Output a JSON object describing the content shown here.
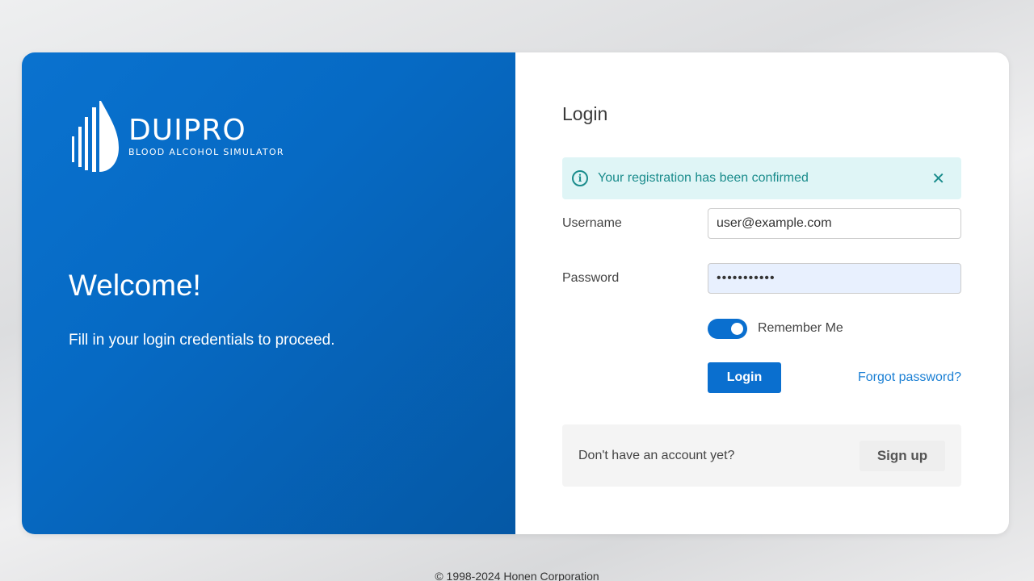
{
  "brand": {
    "name": "DUIPRO",
    "subtitle": "BLOOD ALCOHOL SIMULATOR",
    "logo_icon": "droplet-icon"
  },
  "left_panel": {
    "welcome": "Welcome!",
    "tagline": "Fill in your login credentials to proceed."
  },
  "form": {
    "title": "Login",
    "alert": {
      "icon": "info-icon",
      "message": "Your registration has been confirmed",
      "close_symbol": "✕"
    },
    "username_label": "Username",
    "username_value": "user@example.com",
    "password_label": "Password",
    "password_value": "•••••••••••",
    "remember_label": "Remember Me",
    "remember_on": true,
    "login_label": "Login",
    "forgot_label": "Forgot password?"
  },
  "signup": {
    "question": "Don't have an account yet?",
    "button_label": "Sign up"
  },
  "footer": {
    "copyright": "© 1998-2024 Honen Corporation"
  },
  "colors": {
    "primary": "#0a6fcf",
    "alert_bg": "#dff5f6",
    "alert_text": "#1a8c8c",
    "link": "#1a7fd4"
  }
}
